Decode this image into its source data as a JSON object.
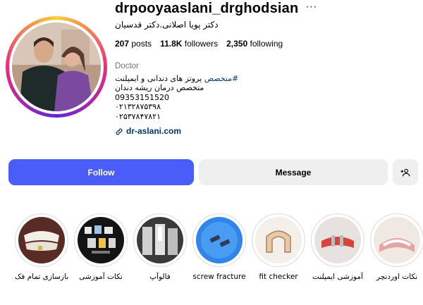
{
  "profile": {
    "username": "drpooyaaslani_drghodsian",
    "full_name": "دکتر پویا اصلانی.دکتر قدسیان",
    "stats": {
      "posts_count": "207",
      "posts_label": "posts",
      "followers_count": "11.8K",
      "followers_label": "followers",
      "following_count": "2,350",
      "following_label": "following"
    },
    "bio": {
      "category": "Doctor",
      "hashtag": "#متخصص",
      "line1_rest": " پروتز های دندانی و ایمپلنت",
      "line2": "متخصص درمان ریشه دندان",
      "line3": "09353151520",
      "line4": "۰۲۱۳۲۸۷۵۳۹۸",
      "line5": "۰۲۵۳۷۸۴۷۸۲۱",
      "link": "dr-aslani.com"
    }
  },
  "actions": {
    "follow_label": "Follow",
    "message_label": "Message",
    "follow_color": "#4a5df9"
  },
  "highlights": [
    {
      "label": "نکات اوردنچر"
    },
    {
      "label": "آموزشی ایمپلنت"
    },
    {
      "label": "fit checker"
    },
    {
      "label": "screw fracture"
    },
    {
      "label": "فالوآپ"
    },
    {
      "label": "نکات آموزشی"
    },
    {
      "label": "بازسازی تمام فک"
    }
  ]
}
